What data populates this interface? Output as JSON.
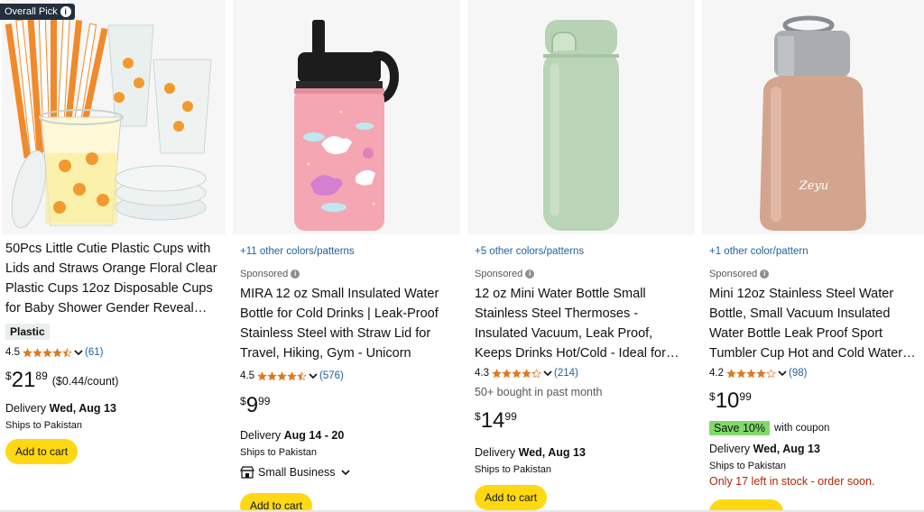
{
  "products": [
    {
      "badge": "Overall Pick",
      "colors_link": "",
      "sponsored": "",
      "title": "50Pcs Little Cutie Plastic Cups with Lids and Straws Orange Floral Clear Plastic Cups 12oz Disposable Cups for Baby Shower Gender Reveal…",
      "pill": "Plastic",
      "rating": "4.5",
      "stars": 4.5,
      "reviews": "(61)",
      "price_symbol": "$",
      "price_whole": "21",
      "price_fraction": "89",
      "unit_price": "($0.44/count)",
      "delivery_prefix": "Delivery ",
      "delivery_date": "Wed, Aug 13",
      "ships": "Ships to Pakistan",
      "cart": "Add to cart"
    },
    {
      "colors_link": "+11 other colors/patterns",
      "sponsored": "Sponsored",
      "title": "MIRA 12 oz Small Insulated Water Bottle for Cold Drinks | Leak-Proof Stainless Steel with Straw Lid for Travel, Hiking, Gym - Unicorn",
      "rating": "4.5",
      "stars": 4.5,
      "reviews": "(576)",
      "price_symbol": "$",
      "price_whole": "9",
      "price_fraction": "99",
      "delivery_prefix": "Delivery ",
      "delivery_date": "Aug 14 - 20",
      "ships": "Ships to Pakistan",
      "small_business": "Small Business",
      "cart": "Add to cart"
    },
    {
      "colors_link": "+5 other colors/patterns",
      "sponsored": "Sponsored",
      "title": "12 oz Mini Water Bottle Small Stainless Steel Thermoses - Insulated Vacuum, Leak Proof, Keeps Drinks Hot/Cold - Ideal for…",
      "rating": "4.3",
      "stars": 4.3,
      "reviews": "(214)",
      "bought": "50+ bought in past month",
      "price_symbol": "$",
      "price_whole": "14",
      "price_fraction": "99",
      "delivery_prefix": "Delivery ",
      "delivery_date": "Wed, Aug 13",
      "ships": "Ships to Pakistan",
      "cart": "Add to cart"
    },
    {
      "colors_link": "+1 other color/pattern",
      "sponsored": "Sponsored",
      "title": "Mini 12oz Stainless Steel Water Bottle, Small Vacuum Insulated Water Bottle Leak Proof Sport Tumbler Cup Hot and Cold Water…",
      "rating": "4.2",
      "stars": 4.2,
      "reviews": "(98)",
      "price_symbol": "$",
      "price_whole": "10",
      "price_fraction": "99",
      "coupon_save": "Save 10%",
      "coupon_with": "with coupon",
      "delivery_prefix": "Delivery ",
      "delivery_date": "Wed, Aug 13",
      "ships": "Ships to Pakistan",
      "stock": "Only 17 left in stock - order soon."
    }
  ],
  "colors": {
    "link": "#2162a1",
    "star": "#de7921",
    "cart_button": "#ffd814",
    "coupon": "#7fda69",
    "stock_warning": "#b12704",
    "badge": "#232f3e"
  }
}
